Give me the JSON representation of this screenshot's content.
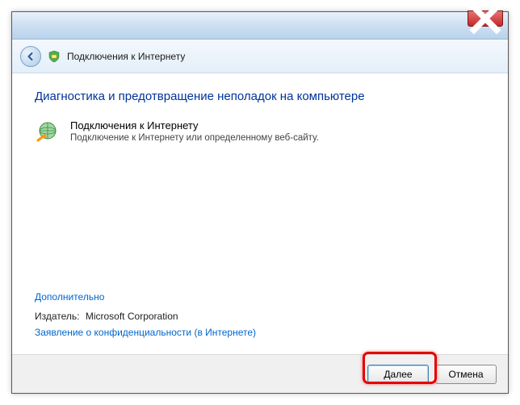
{
  "titlebar": {},
  "header": {
    "title": "Подключения к Интернету"
  },
  "content": {
    "heading": "Диагностика и предотвращение неполадок на компьютере",
    "troubleshooter": {
      "title": "Подключения к Интернету",
      "description": "Подключение к Интернету или определенному веб-сайту."
    },
    "advanced_link": "Дополнительно",
    "publisher_label": "Издатель:",
    "publisher_value": "Microsoft Corporation",
    "privacy_link": "Заявление о конфиденциальности (в Интернете)"
  },
  "footer": {
    "next_label": "Далее",
    "cancel_label": "Отмена"
  }
}
